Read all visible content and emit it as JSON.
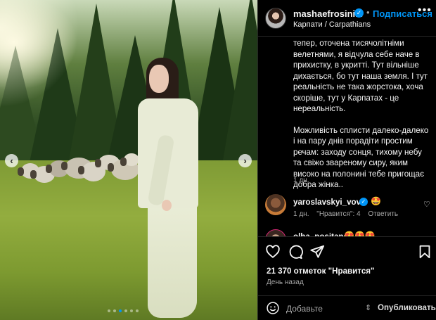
{
  "post": {
    "username": "mashaefrosini...",
    "separator": "•",
    "follow_label": "Подписаться",
    "more_icon": "•••",
    "location": "Карпати / Carpathians",
    "verified_icon": "✓"
  },
  "photo": {
    "prev_icon": "‹",
    "next_icon": "›",
    "slide_count": 6,
    "active_slide": 2
  },
  "caption": {
    "paragraph_1": "тепер, оточена тисячолітніми велетнями, я відчула себе наче в прихистку, в укритті. Тут вільніше дихається, бо тут наша земля. І тут реальність не така жорстока, хоча скоріше, тут у Карпатах - це нереальність.",
    "paragraph_2": "Можливість сплисти далеко-далеко і на пару днів порадіти простим речам: заходу сонця, тихому небу та свіжо звареному сиру, яким високо на полонині тебе пригощає добра жінка..",
    "time": "1 дн."
  },
  "comments": [
    {
      "username": "yaroslavskyi_vova",
      "text": "🤩",
      "time": "1 дн.",
      "likes": "\"Нравится\": 4",
      "reply_label": "Ответить"
    },
    {
      "username": "olha_positano",
      "text": "😍😍😍"
    }
  ],
  "actions": {
    "likes": "21 370 отметок \"Нравится\"",
    "date": "День назад"
  },
  "add_comment": {
    "placeholder": "Добавьте",
    "publish_label": "Опубликовать"
  },
  "colors": {
    "accent": "#0095f6",
    "background": "#000000",
    "secondary_text": "#a8a8a8"
  }
}
